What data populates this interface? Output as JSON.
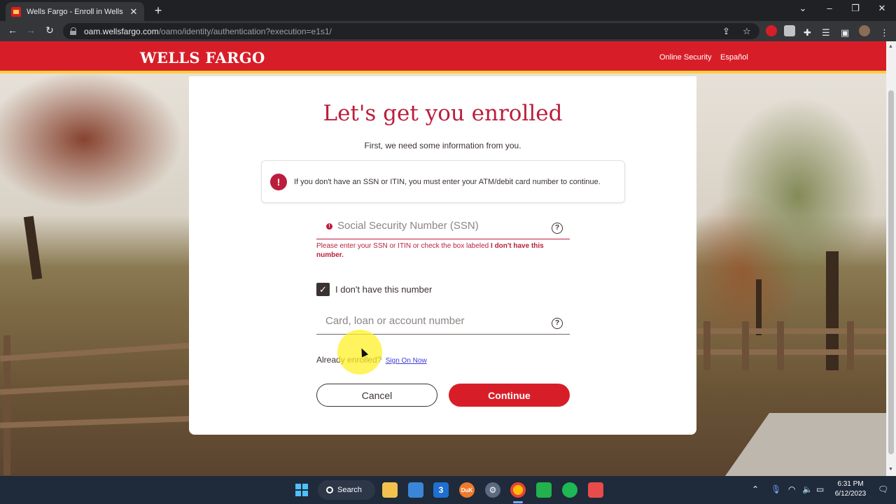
{
  "browser": {
    "tab_title": "Wells Fargo - Enroll in Wells Fargo",
    "tab_close": "✕",
    "new_tab": "+",
    "url_host": "oam.wellsfargo.com",
    "url_path": "/oamo/identity/authentication?execution=e1s1/"
  },
  "header": {
    "brand": "WELLS FARGO",
    "links": [
      "Online Security",
      "Español"
    ]
  },
  "enroll": {
    "title": "Let's get you enrolled",
    "subtitle": "First, we need some information from you.",
    "alert": "If you don't have an SSN or ITIN, you must enter your ATM/debit card number to continue.",
    "ssn_placeholder": "Social Security Number (SSN)",
    "ssn_error_text": "Please enter your SSN or ITIN or check the box labeled ",
    "ssn_error_bold": "I don't have this number.",
    "checkbox_label": "I don't have this number",
    "checkbox_checked": true,
    "account_placeholder": "Card, loan or account number",
    "already_enrolled": "Already enrolled?",
    "sign_on_link": "Sign On Now",
    "cancel_label": "Cancel",
    "continue_label": "Continue"
  },
  "taskbar": {
    "search_label": "Search",
    "time": "6:31 PM",
    "date": "6/12/2023"
  },
  "colors": {
    "brand_red": "#d71e28",
    "brand_gold": "#ffcd41",
    "headline": "#bb1e3c"
  }
}
